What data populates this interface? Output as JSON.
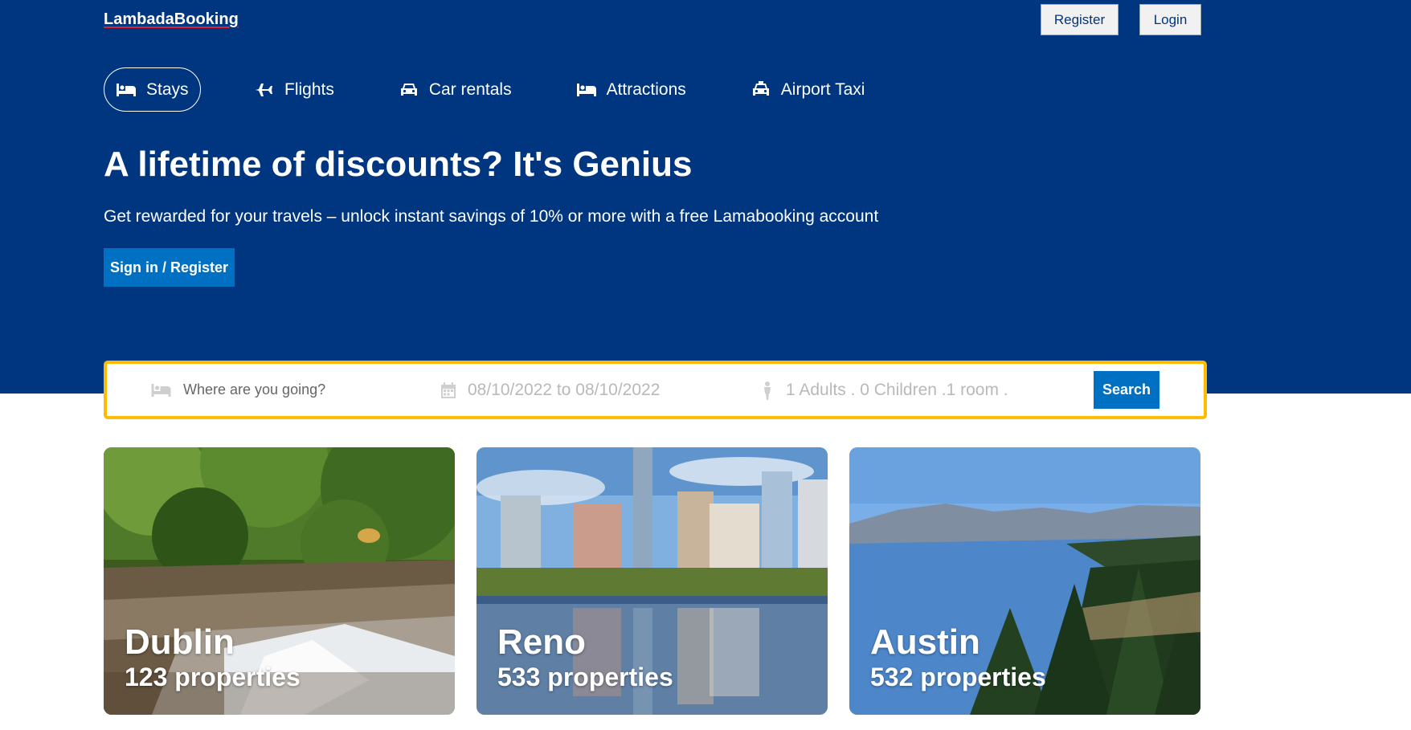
{
  "header": {
    "logo": "LambadaBooking",
    "register_label": "Register",
    "login_label": "Login"
  },
  "nav": {
    "items": [
      {
        "label": "Stays",
        "icon": "bed-icon",
        "active": true
      },
      {
        "label": "Flights",
        "icon": "plane-icon"
      },
      {
        "label": "Car rentals",
        "icon": "car-icon"
      },
      {
        "label": "Attractions",
        "icon": "bed-icon"
      },
      {
        "label": "Airport Taxi",
        "icon": "taxi-icon"
      }
    ]
  },
  "hero": {
    "title": "A lifetime of discounts? It's Genius",
    "subtitle": "Get rewarded for your travels – unlock instant savings of 10% or more with a free Lamabooking account",
    "cta_label": "Sign in / Register"
  },
  "search": {
    "destination_placeholder": "Where are you going?",
    "dates": "08/10/2022 to 08/10/2022",
    "options": "1 Adults . 0 Children .1 room .",
    "button_label": "Search"
  },
  "featured": [
    {
      "city": "Dublin",
      "properties": "123 properties"
    },
    {
      "city": "Reno",
      "properties": "533 properties"
    },
    {
      "city": "Austin",
      "properties": "532 properties"
    }
  ],
  "colors": {
    "header_bg": "#003580",
    "accent": "#0071c2",
    "search_border": "#febb02"
  }
}
